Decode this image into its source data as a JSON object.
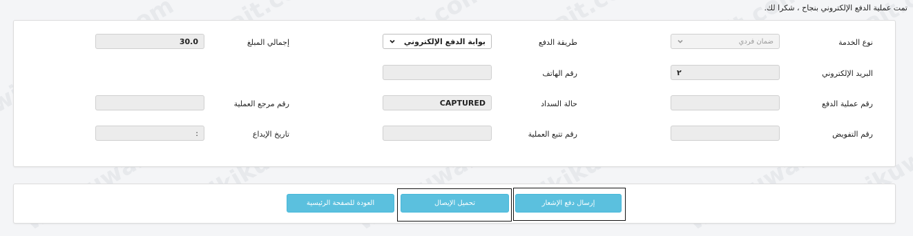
{
  "success_message": "تمت عملية الدفع الإلكتروني بنجاح ، شكرا لك.",
  "form": {
    "service_type": {
      "label": "نوع الخدمة",
      "value": "ضمان فردي"
    },
    "payment_method": {
      "label": "طريقة الدفع",
      "value": "بوابة الدفع الإلكتروني"
    },
    "total_amount": {
      "label": "إجمالي المبلغ",
      "value": "30.0"
    },
    "email": {
      "label": "البريد الإلكتروني",
      "value": "٢"
    },
    "phone": {
      "label": "رقم الهاتف",
      "value": ""
    },
    "payment_number": {
      "label": "رقم عملية الدفع",
      "value": ""
    },
    "payment_status": {
      "label": "حالة السداد",
      "value": "CAPTURED"
    },
    "reference_number": {
      "label": "رقم مرجع العملية",
      "value": ""
    },
    "authorization_number": {
      "label": "رقم التفويض",
      "value": ""
    },
    "tracking_number": {
      "label": "رقم تتبع العملية",
      "value": ""
    },
    "deposit_date": {
      "label": "تاريخ الإيداع",
      "value": ":"
    }
  },
  "actions": {
    "send_notice": "إرسال دفع الإشعار",
    "download_receipt": "تحميل الإيصال",
    "back_home": "العودة للصفحة الرئيسية"
  },
  "watermark": "wikikuwait.com",
  "colors": {
    "button": "#5bc0de",
    "field_bg": "#ececec",
    "panel_bg": "#ffffff",
    "page_bg": "#f4f5f7"
  }
}
